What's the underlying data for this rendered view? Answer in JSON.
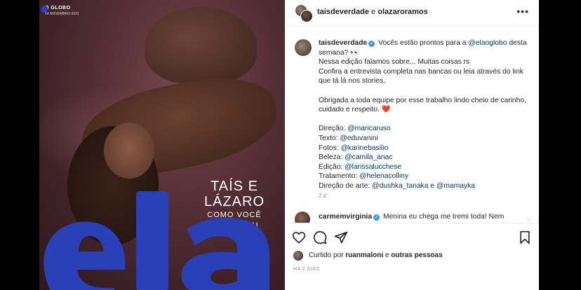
{
  "cover": {
    "brand": "O GLOBO",
    "date": "14 NOVEMBRO 2021",
    "title_line1": "TAÍS E",
    "title_line2": "LÁZARO",
    "subtitle_line1": "COMO VOCÊ",
    "subtitle_line2": "NUNCA VIU",
    "magazine_logo": "ela",
    "logo_color": "#2a40b8"
  },
  "post": {
    "header": {
      "author1": "taisdeverdade",
      "connector": " e ",
      "author2": "olazaroramos",
      "more_icon": "more-horizontal-icon"
    },
    "caption": {
      "user": "taisdeverdade",
      "line1_text": "Vocês estão prontos para a ",
      "line1_link": "@elaoglobo",
      "line1_end": " desta",
      "line2": "semana? 👀",
      "line3": "Nessa edição falamos sobre... Muitas coisas rs",
      "line4": "Confira a entrevista completa nas bancas ou leia através do link",
      "line5": "que tá lá nos stories.",
      "line6": "Obrigada a toda equipe por esse trabalho lindo cheio de carinho,",
      "line7_text": "cuidado e respeito. ",
      "line7_emoji": "❤️",
      "credits": [
        {
          "label": "Direção: ",
          "handle": "@maricaruso"
        },
        {
          "label": "Texto: ",
          "handle": "@eduvanini"
        },
        {
          "label": "Fotos: ",
          "handle": "@karinebasilio"
        },
        {
          "label": "Beleza: ",
          "handle": "@camila_anac"
        },
        {
          "label": "Edição: ",
          "handle": "@larissalucchese"
        },
        {
          "label": "Tratamento: ",
          "handle": "@helenacolliny"
        }
      ],
      "art_label": "Direção de arte: ",
      "art_handle1": "@dushka_tanaka",
      "art_connector": " e ",
      "art_handle2": "@mamayka",
      "time": "2 d"
    },
    "comment": {
      "user": "carmemvirginia",
      "text": "Menina eu chega me tremi toda! Nem"
    },
    "actions": {
      "like_icon": "heart-icon",
      "comment_icon": "comment-icon",
      "share_icon": "share-icon",
      "save_icon": "bookmark-icon"
    },
    "likes": {
      "prefix": "Curtido por ",
      "user": "ruanmaloni",
      "connector": " e ",
      "others": "outras pessoas"
    },
    "posted_ago": "HÁ 2 DIAS"
  },
  "colors": {
    "link": "#00376b",
    "verified": "#3897f0",
    "heart": "#ed4956"
  }
}
